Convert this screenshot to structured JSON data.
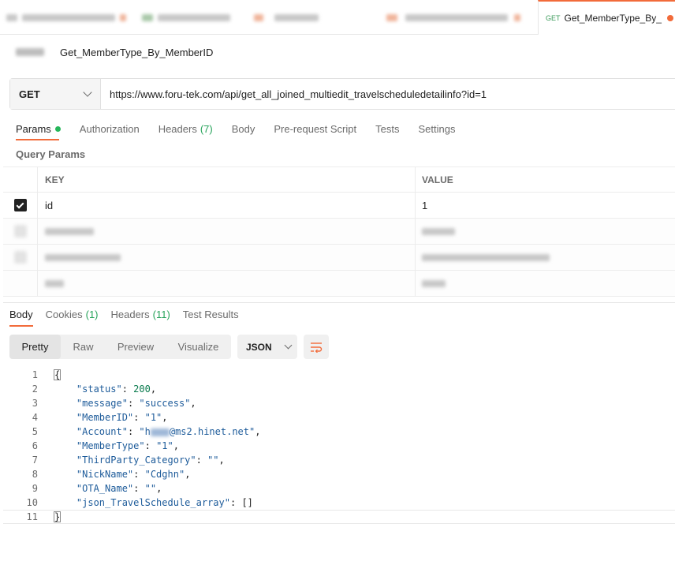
{
  "tabs": {
    "active_method": "GET",
    "active_title": "Get_MemberType_By_"
  },
  "request": {
    "name": "Get_MemberType_By_MemberID",
    "method": "GET",
    "url": "https://www.foru-tek.com/api/get_all_joined_multiedit_travelscheduledetailinfo?id=1"
  },
  "request_tabs": [
    {
      "label": "Params",
      "count": ""
    },
    {
      "label": "Authorization",
      "count": ""
    },
    {
      "label": "Headers",
      "count": "(7)"
    },
    {
      "label": "Body",
      "count": ""
    },
    {
      "label": "Pre-request Script",
      "count": ""
    },
    {
      "label": "Tests",
      "count": ""
    },
    {
      "label": "Settings",
      "count": ""
    }
  ],
  "query_params": {
    "label": "Query Params",
    "key_header": "KEY",
    "value_header": "VALUE",
    "rows": [
      {
        "key": "id",
        "value": "1",
        "checked": true
      }
    ]
  },
  "response_tabs": [
    {
      "label": "Body",
      "count": ""
    },
    {
      "label": "Cookies",
      "count": "(1)"
    },
    {
      "label": "Headers",
      "count": "(11)"
    },
    {
      "label": "Test Results",
      "count": ""
    }
  ],
  "format": {
    "options": [
      "Pretty",
      "Raw",
      "Preview",
      "Visualize"
    ],
    "active": "Pretty",
    "language": "JSON"
  },
  "response_lines": [
    {
      "n": "1",
      "text": "{"
    },
    {
      "n": "2",
      "key": "\"status\"",
      "val": "200",
      "type": "num",
      "comma": ","
    },
    {
      "n": "3",
      "key": "\"message\"",
      "val": "\"success\"",
      "type": "str",
      "comma": ","
    },
    {
      "n": "4",
      "key": "\"MemberID\"",
      "val": "\"1\"",
      "type": "str",
      "comma": ","
    },
    {
      "n": "5",
      "key": "\"Account\"",
      "val_pre": "\"h",
      "val_post": "@ms2.hinet.net\"",
      "type": "masked",
      "comma": ","
    },
    {
      "n": "6",
      "key": "\"MemberType\"",
      "val": "\"1\"",
      "type": "str",
      "comma": ","
    },
    {
      "n": "7",
      "key": "\"ThirdParty_Category\"",
      "val": "\"\"",
      "type": "str",
      "comma": ","
    },
    {
      "n": "8",
      "key": "\"NickName\"",
      "val": "\"Cdghn\"",
      "type": "str",
      "comma": ","
    },
    {
      "n": "9",
      "key": "\"OTA_Name\"",
      "val": "\"\"",
      "type": "str",
      "comma": ","
    },
    {
      "n": "10",
      "key": "\"json_TravelSchedule_array\"",
      "val": "[]",
      "type": "plain",
      "comma": ""
    },
    {
      "n": "11",
      "text": "}"
    }
  ]
}
